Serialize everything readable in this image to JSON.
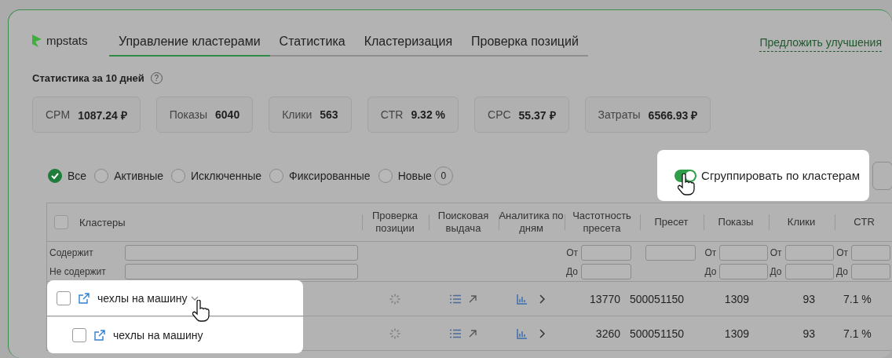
{
  "logo": {
    "text": "mpstats"
  },
  "tabs": [
    {
      "label": "Управление кластерами",
      "selected": true
    },
    {
      "label": "Статистика",
      "selected": false
    },
    {
      "label": "Кластеризация",
      "selected": false
    },
    {
      "label": "Проверка позиций",
      "selected": false
    }
  ],
  "suggest_link": "Предложить улучшения",
  "stats_title": "Статистика за 10 дней",
  "stats_help": "?",
  "stats": [
    {
      "label": "CPM",
      "value": "1087.24 ₽"
    },
    {
      "label": "Показы",
      "value": "6040"
    },
    {
      "label": "Клики",
      "value": "563"
    },
    {
      "label": "CTR",
      "value": "9.32 %"
    },
    {
      "label": "CPC",
      "value": "55.37 ₽"
    },
    {
      "label": "Затраты",
      "value": "6566.93 ₽"
    }
  ],
  "filters": [
    {
      "label": "Все",
      "selected": true
    },
    {
      "label": "Активные",
      "selected": false
    },
    {
      "label": "Исключенные",
      "selected": false
    },
    {
      "label": "Фиксированные",
      "selected": false
    },
    {
      "label": "Новые",
      "selected": false,
      "count": "0"
    }
  ],
  "group_toggle": {
    "label": "Сгруппировать по кластерам",
    "on": true
  },
  "table": {
    "all_checked": false,
    "columns": [
      {
        "label": "Кластеры",
        "filter": {
          "kind": "text",
          "labels": [
            "Содержит",
            "Не содержит"
          ]
        }
      },
      {
        "label": "Проверка позиции",
        "filter": {
          "kind": "none"
        }
      },
      {
        "label": "Поисковая выдача",
        "filter": {
          "kind": "none"
        }
      },
      {
        "label": "Аналитика по дням",
        "filter": {
          "kind": "none"
        }
      },
      {
        "label": "Частотность пресета",
        "filter": {
          "kind": "range",
          "from": "От",
          "to": "До"
        }
      },
      {
        "label": "Пресет",
        "filter": {
          "kind": "single"
        }
      },
      {
        "label": "Показы",
        "filter": {
          "kind": "range",
          "from": "От",
          "to": "До"
        }
      },
      {
        "label": "Клики",
        "filter": {
          "kind": "range",
          "from": "От",
          "to": "До"
        }
      },
      {
        "label": "CTR",
        "filter": {
          "kind": "range",
          "from": "От",
          "to": "До"
        }
      }
    ],
    "rows": [
      {
        "name": "чехлы на машину",
        "checked": false,
        "expanded": true,
        "frequency": "13770",
        "preset": "500051150",
        "shows": "1309",
        "clicks": "93",
        "ctr": "7.1 %",
        "children": [
          {
            "name": "чехлы на машину",
            "checked": false,
            "frequency": "3260",
            "preset": "500051150",
            "shows": "1309",
            "clicks": "93",
            "ctr": "7.1 %"
          }
        ]
      }
    ]
  }
}
